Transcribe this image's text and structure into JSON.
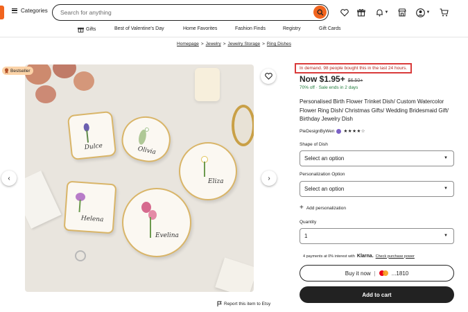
{
  "header": {
    "categories_label": "Categories",
    "search_placeholder": "Search for anything"
  },
  "nav": {
    "items": [
      "Gifts",
      "Best of Valentine's Day",
      "Home Favorites",
      "Fashion Finds",
      "Registry",
      "Gift Cards"
    ]
  },
  "breadcrumb": [
    "Homepage",
    "Jewelry",
    "Jewelry Storage",
    "Ring Dishes"
  ],
  "gallery": {
    "badge": "Bestseller",
    "dish_names": [
      "Dulce",
      "Olivia",
      "Eliza",
      "Helena",
      "Evelina"
    ],
    "report_link": "Report this item to Etsy"
  },
  "listing": {
    "demand_notice": "In demand. 98 people bought this in the last 24 hours.",
    "price_now": "Now $1.95+",
    "price_old": "$6.50+",
    "sale_text": "70% off · Sale ends in 2 days",
    "title": "Personalised Birth Flower Trinket Dish/ Custom Watercolor Flower Ring Dish/ Christmas Gifts/ Wedding Bridesmaid Gift/ Birthday Jewelry Dish",
    "shop_name": "PieDesignByWen",
    "rating_stars": "★★★★☆",
    "shape_label": "Shape of Dish",
    "shape_value": "Select an option",
    "personalization_label": "Personalization Option",
    "personalization_value": "Select an option",
    "add_personalization": "Add personalization",
    "quantity_label": "Quantity",
    "quantity_value": "1",
    "klarna_text": "4 payments at 0% interest with",
    "klarna_brand": "Klarna.",
    "klarna_link": "Check purchase power",
    "buy_now_label": "Buy it now",
    "card_sep": "|",
    "card_last4": "...1810",
    "add_to_cart": "Add to cart"
  },
  "colors": {
    "accent": "#f1641e",
    "demand_border": "#d93a3a",
    "sale_green": "#1f7a3a"
  }
}
